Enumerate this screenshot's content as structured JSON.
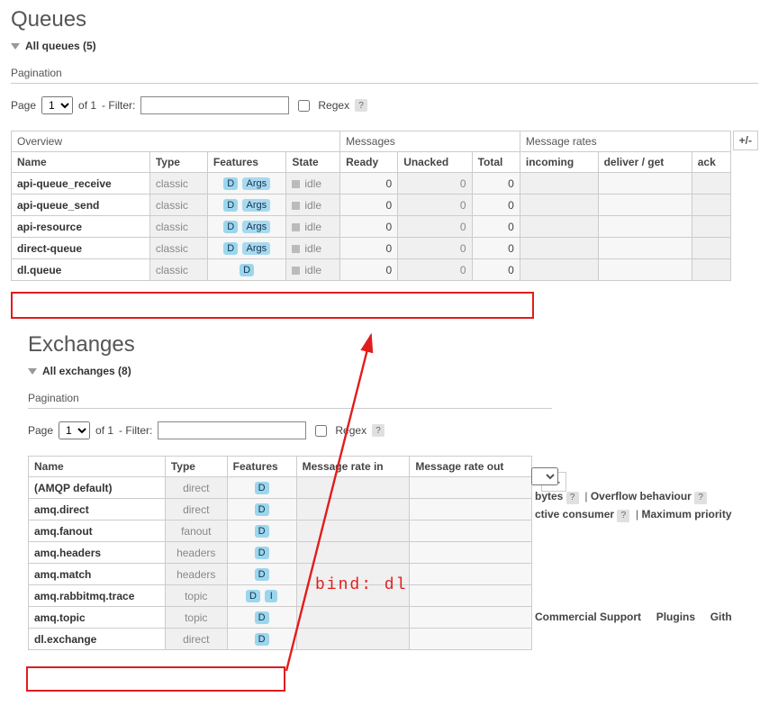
{
  "queues": {
    "title": "Queues",
    "toggle": "All queues (5)",
    "pagination_label": "Pagination",
    "page_label": "Page",
    "of_label": "of 1",
    "filter_label": "- Filter:",
    "regex_label": "Regex",
    "help": "?",
    "plusminus": "+/-",
    "groups": {
      "overview": "Overview",
      "messages": "Messages",
      "rates": "Message rates"
    },
    "cols": {
      "name": "Name",
      "type": "Type",
      "features": "Features",
      "state": "State",
      "ready": "Ready",
      "unacked": "Unacked",
      "total": "Total",
      "incoming": "incoming",
      "deliver": "deliver / get",
      "ack": "ack"
    },
    "rows": [
      {
        "name": "api-queue_receive",
        "type": "classic",
        "features": [
          "D",
          "Args"
        ],
        "state": "idle",
        "ready": 0,
        "unacked": 0,
        "total": 0
      },
      {
        "name": "api-queue_send",
        "type": "classic",
        "features": [
          "D",
          "Args"
        ],
        "state": "idle",
        "ready": 0,
        "unacked": 0,
        "total": 0
      },
      {
        "name": "api-resource",
        "type": "classic",
        "features": [
          "D",
          "Args"
        ],
        "state": "idle",
        "ready": 0,
        "unacked": 0,
        "total": 0
      },
      {
        "name": "direct-queue",
        "type": "classic",
        "features": [
          "D",
          "Args"
        ],
        "state": "idle",
        "ready": 0,
        "unacked": 0,
        "total": 0
      },
      {
        "name": "dl.queue",
        "type": "classic",
        "features": [
          "D"
        ],
        "state": "idle",
        "ready": 0,
        "unacked": 0,
        "total": 0
      }
    ]
  },
  "exchanges": {
    "title": "Exchanges",
    "toggle": "All exchanges (8)",
    "pagination_label": "Pagination",
    "page_label": "Page",
    "of_label": "of 1",
    "filter_label": "- Filter:",
    "regex_label": "Regex",
    "help": "?",
    "plusminus": "+/-",
    "cols": {
      "name": "Name",
      "type": "Type",
      "features": "Features",
      "rate_in": "Message rate in",
      "rate_out": "Message rate out"
    },
    "rows": [
      {
        "name": "(AMQP default)",
        "type": "direct",
        "features": [
          "D"
        ]
      },
      {
        "name": "amq.direct",
        "type": "direct",
        "features": [
          "D"
        ]
      },
      {
        "name": "amq.fanout",
        "type": "fanout",
        "features": [
          "D"
        ]
      },
      {
        "name": "amq.headers",
        "type": "headers",
        "features": [
          "D"
        ]
      },
      {
        "name": "amq.match",
        "type": "headers",
        "features": [
          "D"
        ]
      },
      {
        "name": "amq.rabbitmq.trace",
        "type": "topic",
        "features": [
          "D",
          "I"
        ]
      },
      {
        "name": "amq.topic",
        "type": "topic",
        "features": [
          "D"
        ]
      },
      {
        "name": "dl.exchange",
        "type": "direct",
        "features": [
          "D"
        ]
      }
    ]
  },
  "annotation": {
    "bind_label": "bind: dl"
  },
  "peek": {
    "bytes": "bytes",
    "overflow": "Overflow behaviour",
    "consumer": "ctive consumer",
    "maxprio": "Maximum priority",
    "commercial": "Commercial Support",
    "plugins": "Plugins",
    "git": "Gith",
    "q1": "?",
    "q2": "?",
    "q3": "?",
    "q4": "?"
  }
}
